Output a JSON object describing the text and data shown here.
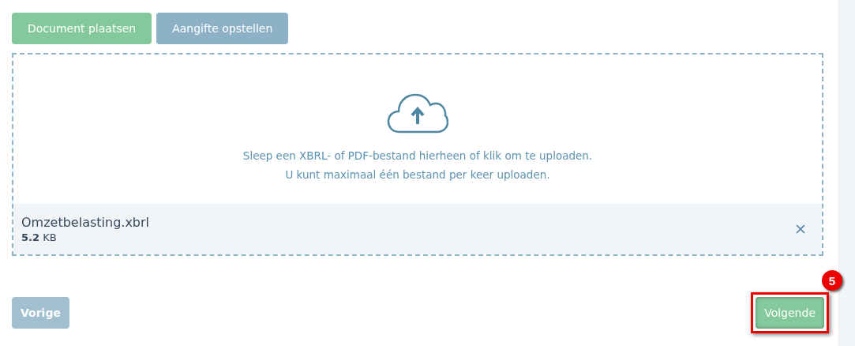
{
  "tabs": [
    {
      "label": "Document plaatsen",
      "selected": true
    },
    {
      "label": "Aangifte opstellen",
      "selected": false
    }
  ],
  "dropzone": {
    "lines": [
      "Sleep een XBRL- of PDF-bestand hierheen of klik om te uploaden.",
      "U kunt maximaal één bestand per keer uploaden."
    ]
  },
  "files": [
    {
      "name": "Omzetbelasting.xbrl",
      "size": "**5.2** KB"
    }
  ],
  "navigation": [
    {
      "label": "Vorige",
      "kind": "back"
    },
    {
      "label": "Volgende",
      "kind": "next",
      "callout": "5"
    }
  ]
}
